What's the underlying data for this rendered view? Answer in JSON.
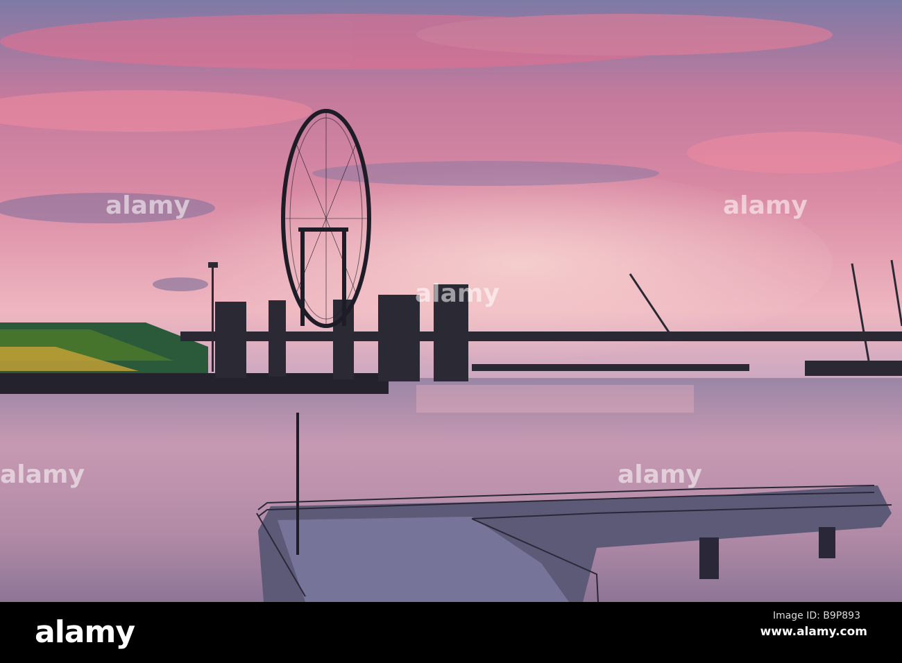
{
  "photo": {
    "subject": "Singapore Flyer at sunset",
    "colors": {
      "sky_top": "#8a7fa8",
      "sky_pink": "#e8849a",
      "horizon": "#f2c0c4",
      "water": "#b98ea8",
      "silhouette": "#1e1c26"
    }
  },
  "watermark": {
    "text": "alamy"
  },
  "footer": {
    "logo": "alamy",
    "image_id": "Image ID: B9P893",
    "website": "www.alamy.com"
  }
}
